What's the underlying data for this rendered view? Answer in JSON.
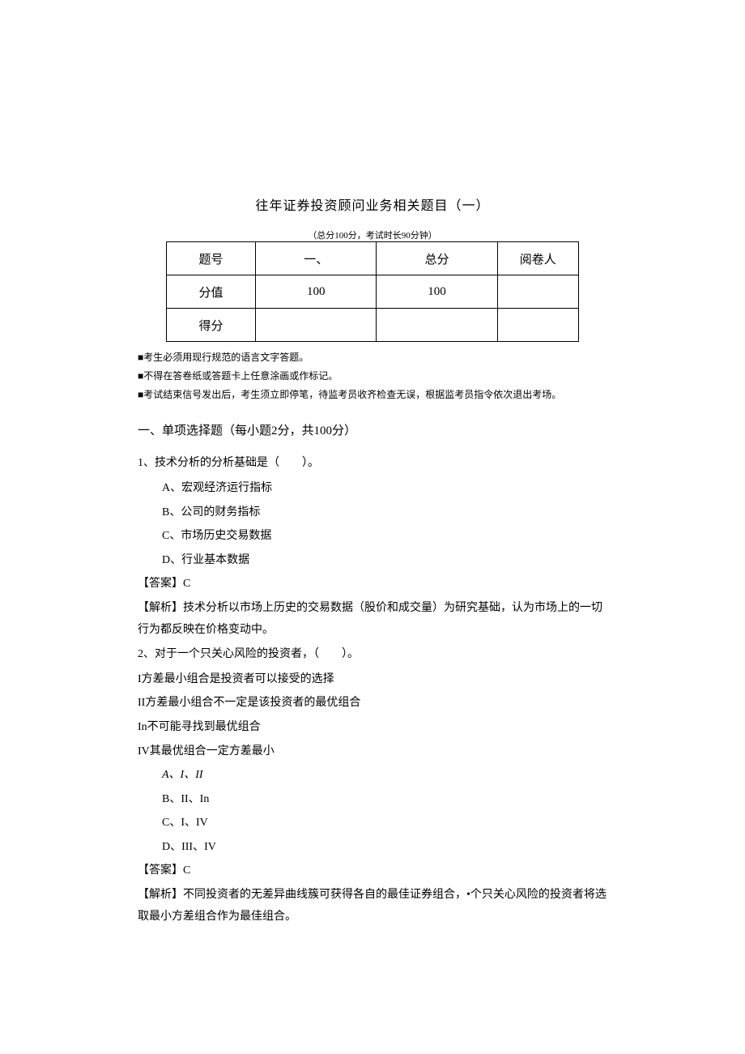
{
  "title": "往年证券投资顾问业务相关题目（一）",
  "subtitle": "（总分100分，考试时长90分钟）",
  "table": {
    "row1": {
      "c1": "题号",
      "c2": "一、",
      "c3": "总分",
      "c4": "阅卷人"
    },
    "row2": {
      "c1": "分值",
      "c2": "100",
      "c3": "100",
      "c4": ""
    },
    "row3": {
      "c1": "得分",
      "c2": "",
      "c3": "",
      "c4": ""
    }
  },
  "notes": {
    "n1": "■考生必须用现行规范的语言文字答题。",
    "n2": "■不得在答卷纸或答题卡上任意涂画或作标记。",
    "n3": "■考试结束信号发出后，考生须立即停笔，待监考员收齐检查无误，根据监考员指令依次退出考场。"
  },
  "section": "一、单项选择题（每小题2分，共100分）",
  "q1": {
    "stem": "1、技术分析的分析基础是（　　）。",
    "a": "A、宏观经济运行指标",
    "b": "B、公司的财务指标",
    "c": "C、市场历史交易数据",
    "d": "D、行业基本数据",
    "ans": "【答案】C",
    "exp": "【解析】技术分析以市场上历史的交易数据（股价和成交量）为研究基础，认为市场上的一切行为都反映在价格变动中。"
  },
  "q2": {
    "stem": "2、对于一个只关心风险的投资者，（　　）。",
    "s1": "I方差最小组合是投资者可以接受的选择",
    "s2": "II方差最小组合不一定是该投资者的最优组合",
    "s3": "In不可能寻找到最优组合",
    "s4": "IV其最优组合一定方差最小",
    "a": "A、I、II",
    "b": "B、II、In",
    "c": "C、I、IV",
    "d": "D、III、IV",
    "ans": "【答案】C",
    "exp": "【解析】不同投资者的无差异曲线簇可获得各自的最佳证券组合，•个只关心风险的投资者将选取最小方差组合作为最佳组合。"
  }
}
